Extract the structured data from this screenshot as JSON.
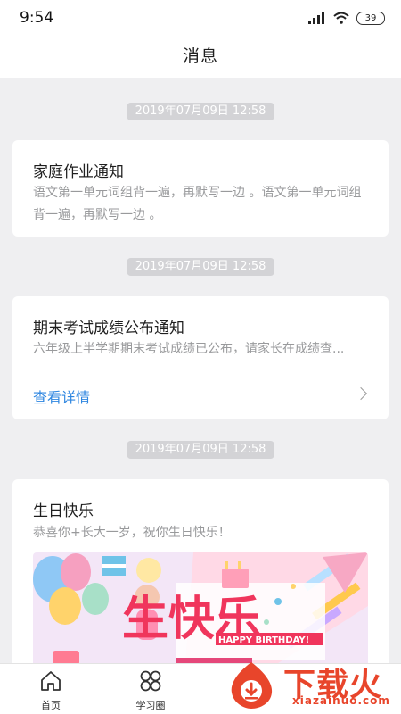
{
  "status_bar": {
    "time": "9:54",
    "battery": "39"
  },
  "header": {
    "title": "消息"
  },
  "messages": [
    {
      "time": "2019年07月09日 12:58",
      "title": "家庭作业通知",
      "body": "语文第一单元词组背一遍，再默写一边 。语文第一单元词组背一遍，再默写一边 。"
    },
    {
      "time": "2019年07月09日 12:58",
      "title": "期末考试成绩公布通知",
      "body": "六年级上半学期期末考试成绩已公布，请家长在成绩查...",
      "link": "查看详情"
    },
    {
      "time": "2019年07月09日 12:58",
      "title": "生日快乐",
      "body": "恭喜你+长大一岁，祝你生日快乐！",
      "banner": {
        "headline": "生快乐",
        "subtitle": "HAPPY BIRTHDAY!"
      }
    }
  ],
  "bottom_nav": [
    {
      "label": "首页",
      "icon": "home-icon"
    },
    {
      "label": "学习圈",
      "icon": "four-circles-icon"
    }
  ],
  "watermark": {
    "text": "下载火",
    "url": "xiazaihuo.com"
  },
  "colors": {
    "accent": "#2e86e0",
    "background": "#efeff1",
    "watermark": "#e8452b"
  }
}
